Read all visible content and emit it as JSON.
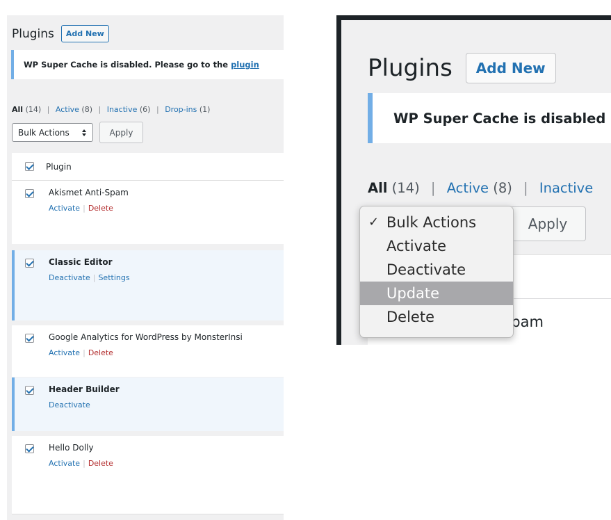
{
  "left": {
    "title": "Plugins",
    "add_new": "Add New",
    "notice": {
      "text": "WP Super Cache is disabled. Please go to the",
      "link": "plugin"
    },
    "filters": [
      {
        "label": "All",
        "count": "(14)",
        "current": true
      },
      {
        "label": "Active",
        "count": "(8)"
      },
      {
        "label": "Inactive",
        "count": "(6)"
      },
      {
        "label": "Drop-ins",
        "count": "(1)"
      }
    ],
    "bulk_actions": "Bulk Actions",
    "apply": "Apply",
    "column_header": "Plugin",
    "plugins": [
      {
        "name": "Akismet Anti-Spam",
        "actions": [
          "Activate",
          "Delete"
        ],
        "active": false
      },
      {
        "name": "Classic Editor",
        "actions": [
          "Deactivate",
          "Settings"
        ],
        "active": true
      },
      {
        "name": "Google Analytics for WordPress by MonsterInsi",
        "actions": [
          "Activate",
          "Delete"
        ],
        "active": false
      },
      {
        "name": "Header Builder",
        "actions": [
          "Deactivate"
        ],
        "active": true
      },
      {
        "name": "Hello Dolly",
        "actions": [
          "Activate",
          "Delete"
        ],
        "active": false
      }
    ]
  },
  "right": {
    "title": "Plugins",
    "add_new": "Add New",
    "notice": "WP Super Cache is disabled",
    "filters": [
      {
        "label": "All",
        "count": "(14)",
        "current": true
      },
      {
        "label": "Active",
        "count": "(8)"
      },
      {
        "label": "Inactive",
        "count": ""
      }
    ],
    "apply": "Apply",
    "dropdown": {
      "selected_mark": "✓",
      "highlighted": "Update",
      "options": [
        "Bulk Actions",
        "Activate",
        "Deactivate",
        "Update",
        "Delete"
      ]
    },
    "row_fragment": "nti-Spam"
  },
  "colors": {
    "link": "#2271b1",
    "delete": "#b32d2e",
    "notice_border": "#72aee6",
    "highlight": "#a8a8ab"
  }
}
